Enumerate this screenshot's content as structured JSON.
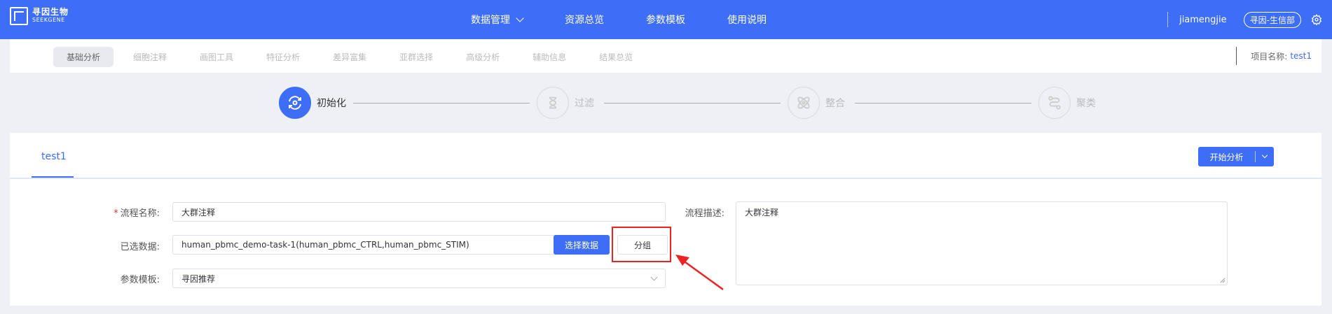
{
  "topbar": {
    "logo_cn": "寻因生物",
    "logo_en": "SEEKGENE",
    "nav": [
      {
        "label": "数据管理",
        "has_dropdown": true
      },
      {
        "label": "资源总览",
        "has_dropdown": false
      },
      {
        "label": "参数模板",
        "has_dropdown": false
      },
      {
        "label": "使用说明",
        "has_dropdown": false
      }
    ],
    "username": "jiamengjie",
    "org": "寻因-生信部",
    "settings_icon": "gear-icon"
  },
  "subtabs": [
    "基础分析",
    "细胞注释",
    "画图工具",
    "特征分析",
    "差异富集",
    "亚群选择",
    "高级分析",
    "辅助信息",
    "结果总览"
  ],
  "project": {
    "label": "项目名称:",
    "value": "test1"
  },
  "steps": [
    {
      "label": "初始化",
      "icon": "refresh-icon",
      "active": true
    },
    {
      "label": "过滤",
      "icon": "hourglass-icon",
      "active": false
    },
    {
      "label": "整合",
      "icon": "atom-icon",
      "active": false
    },
    {
      "label": "聚类",
      "icon": "route-icon",
      "active": false
    }
  ],
  "card": {
    "tab": "test1",
    "start_button": "开始分析",
    "form": {
      "name_label": "流程名称:",
      "name_value": "大群注释",
      "data_label": "已选数据:",
      "data_value": "human_pbmc_demo-task-1(human_pbmc_CTRL,human_pbmc_STIM)",
      "select_data_button": "选择数据",
      "group_button": "分组",
      "template_label": "参数模板:",
      "template_value": "寻因推荐",
      "desc_label": "流程描述:",
      "desc_value": "大群注释"
    }
  },
  "colors": {
    "primary": "#3d6ef5",
    "highlight": "#e22222"
  }
}
